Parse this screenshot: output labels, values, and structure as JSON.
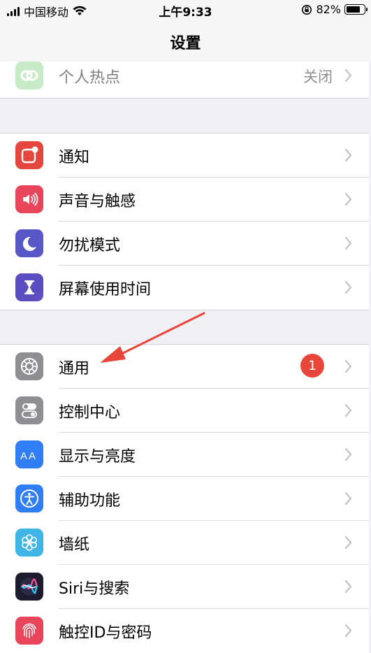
{
  "status_bar": {
    "carrier": "中国移动",
    "time": "上午9:33",
    "battery_pct": "82%",
    "battery_level": 0.82
  },
  "nav": {
    "title": "设置"
  },
  "hotspot": {
    "label": "个人热点",
    "value": "关闭",
    "icon": "hotspot-icon",
    "color": "#8fd98f"
  },
  "group1": [
    {
      "label": "通知",
      "icon": "notification-icon",
      "color": "#e5473e"
    },
    {
      "label": "声音与触感",
      "icon": "speaker-icon",
      "color": "#e8455b"
    },
    {
      "label": "勿扰模式",
      "icon": "moon-icon",
      "color": "#5757c8"
    },
    {
      "label": "屏幕使用时间",
      "icon": "hourglass-icon",
      "color": "#5a4ec0"
    }
  ],
  "group2": [
    {
      "label": "通用",
      "icon": "gear-icon",
      "color": "#8e8e93",
      "badge": "1"
    },
    {
      "label": "控制中心",
      "icon": "toggles-icon",
      "color": "#8e8e93"
    },
    {
      "label": "显示与亮度",
      "icon": "text-size-icon",
      "color": "#2f7ef5"
    },
    {
      "label": "辅助功能",
      "icon": "accessibility-icon",
      "color": "#2f7ef5"
    },
    {
      "label": "墙纸",
      "icon": "flower-icon",
      "color": "#3fb6e6"
    },
    {
      "label": "Siri与搜索",
      "icon": "siri-icon",
      "color": "#1c1c2e"
    },
    {
      "label": "触控ID与密码",
      "icon": "fingerprint-icon",
      "color": "#e8455b"
    }
  ],
  "annotation": {
    "color": "#e8463b"
  }
}
